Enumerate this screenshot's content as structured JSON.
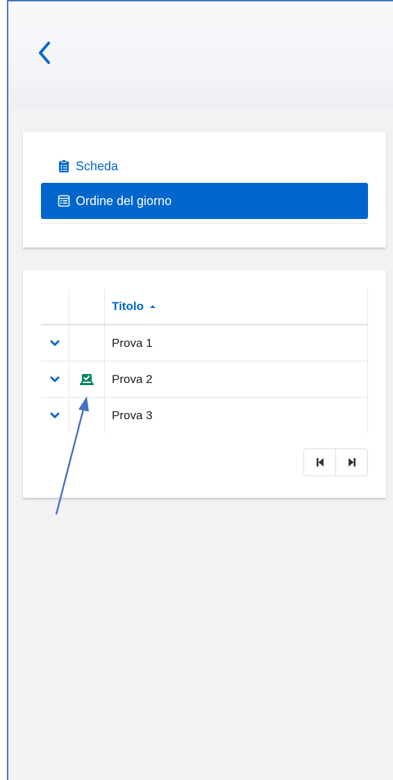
{
  "nav": {
    "items": [
      {
        "label": "Scheda",
        "icon": "clipboard-list-icon",
        "active": false
      },
      {
        "label": "Ordine del giorno",
        "icon": "agenda-icon",
        "active": true
      }
    ]
  },
  "table": {
    "columns": [
      "",
      "",
      "Titolo"
    ],
    "sort": "ascending",
    "rows": [
      {
        "title": "Prova 1",
        "status_icon": null
      },
      {
        "title": "Prova 2",
        "status_icon": "voting-box-check-icon"
      },
      {
        "title": "Prova 3",
        "status_icon": null
      }
    ]
  },
  "colors": {
    "accent": "#0066cc",
    "status_green": "#008758",
    "background": "#f2f2f4",
    "annotation_arrow": "#4472c4"
  }
}
